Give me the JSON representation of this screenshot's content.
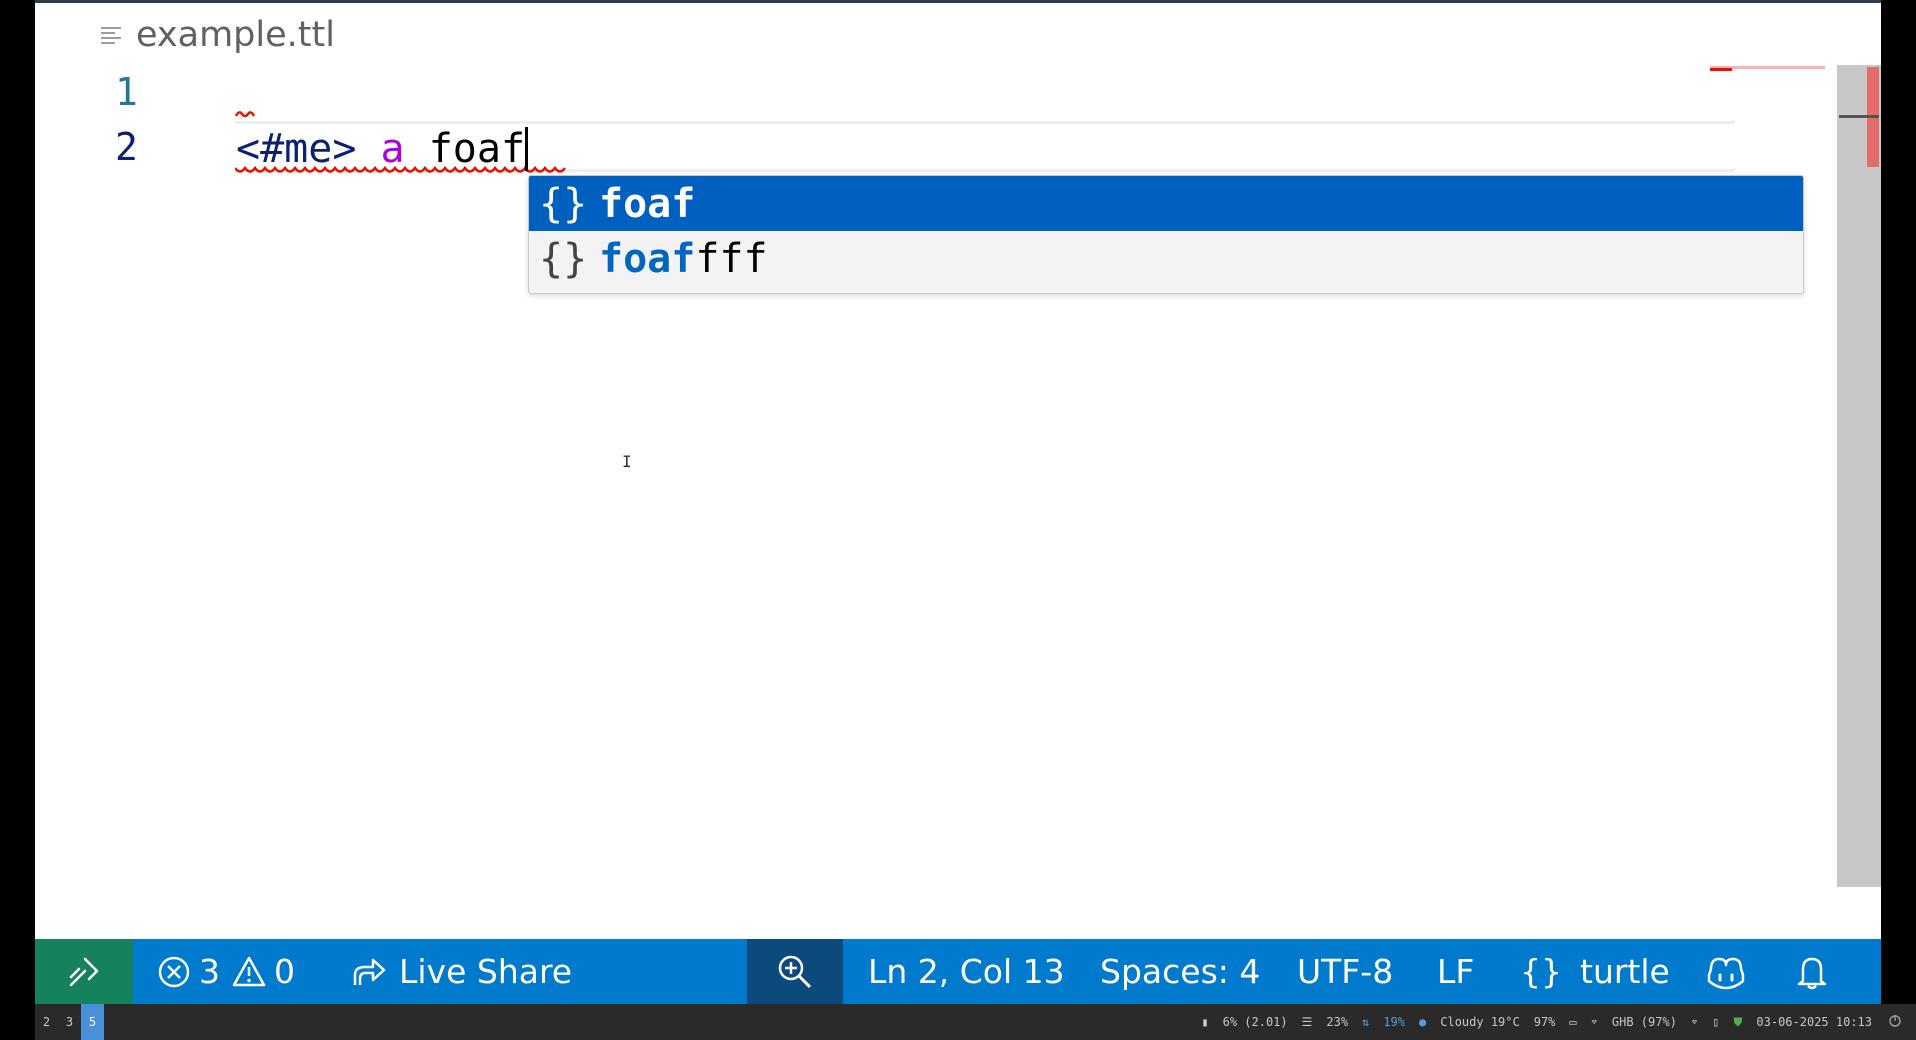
{
  "editor": {
    "breadcrumb": {
      "icon": "lines-icon",
      "label": "example.ttl"
    },
    "line_numbers": [
      "1",
      "2"
    ],
    "code": {
      "uri": "<#me>",
      "keyword": "a",
      "typed": "foaf"
    },
    "suggestions": [
      {
        "icon": "{}",
        "match": "foaf",
        "rest": "",
        "selected": true
      },
      {
        "icon": "{}",
        "match": "foaf",
        "rest": "fff",
        "selected": false
      }
    ],
    "pointer_glyph": "I"
  },
  "statusbar": {
    "errors": "3",
    "warnings": "0",
    "live_share": "Live Share",
    "position": "Ln 2, Col 13",
    "spaces": "Spaces: 4",
    "encoding": "UTF-8",
    "eol": "LF",
    "language_icon": "{}",
    "language": "turtle",
    "colors": {
      "background": "#007acc",
      "remote": "#16825d",
      "zoom": "#0c4a7e"
    }
  },
  "taskbar": {
    "workspaces": [
      "2",
      "3",
      "5"
    ],
    "active_workspace": "5",
    "cpu": "6% (2.01)",
    "memory": "23%",
    "net": "19%",
    "weather": "Cloudy 19°C",
    "battery": "97%",
    "wifi": "GHB (97%)",
    "datetime": "03-06-2025 10:13"
  }
}
